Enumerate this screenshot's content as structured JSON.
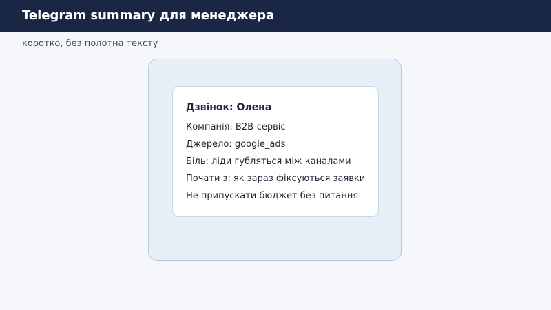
{
  "header": {
    "title": "Telegram summary для менеджера"
  },
  "subtitle": "коротко, без полотна тексту",
  "card": {
    "title": "Дзвінок: Олена",
    "lines": [
      "Компанія: B2B-сервіс",
      "Джерело: google_ads",
      "Біль: ліди губляться між каналами",
      "Почати з: як зараз фіксуються заявки",
      "Не припускати бюджет без питання"
    ]
  },
  "colors": {
    "header_bg": "#1a2744",
    "page_bg": "#f5f7fb",
    "panel_bg": "#e6eef7",
    "card_bg": "#ffffff"
  }
}
